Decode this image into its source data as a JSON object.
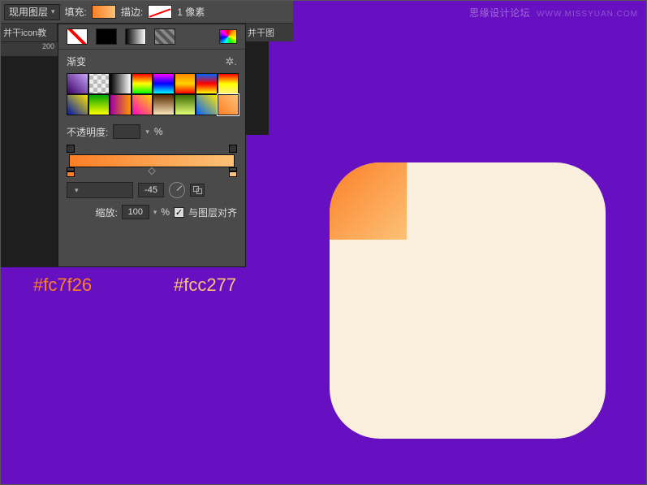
{
  "options": {
    "layer_mode": "现用图层",
    "fill_label": "填充:",
    "stroke_label": "描边:",
    "stroke_value": "1 像素"
  },
  "tab": {
    "left_fragment": "并干icon教",
    "right_fragment": "并干图"
  },
  "ruler": {
    "tick": "200"
  },
  "popup": {
    "presets_label": "渐变",
    "gear_icon": "✶",
    "opacity_label": "不透明度:",
    "opacity_value": "",
    "percent": "%",
    "angle_value": "-45",
    "scale_label": "缩放:",
    "scale_value": "100",
    "align_label": "与图层对齐",
    "align_checked": "✓"
  },
  "hex": {
    "c1": "#fc7f26",
    "c2": "#fcc277"
  },
  "watermark": {
    "zh": "思缘设计论坛",
    "en": "WWW.MISSYUAN.COM"
  }
}
